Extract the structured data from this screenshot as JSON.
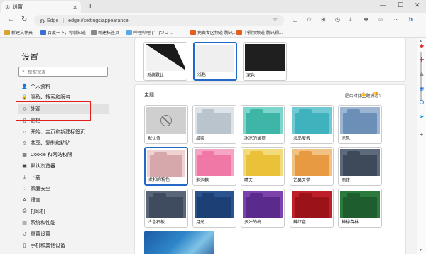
{
  "browser": {
    "tab_title": "设置",
    "address_brand": "Edge",
    "address_url": "edge://settings/appearance",
    "favorites": [
      {
        "label": "新建文件夹",
        "color": "#d9a531"
      },
      {
        "label": "百度一下，你就知道",
        "color": "#3a6fd8"
      },
      {
        "label": "新建标签页",
        "color": "#888888"
      },
      {
        "label": "哔哩哔哩 ( '- ')つロ ...",
        "color": "#5aa9e6"
      },
      {
        "label": "免费专区频道-腾讯...",
        "color": "#e65c1a"
      },
      {
        "label": "中视频频道-腾讯视...",
        "color": "#e65c1a"
      }
    ]
  },
  "sidebar": {
    "title": "设置",
    "search_placeholder": "搜索设置",
    "items": [
      {
        "label": "个人资料",
        "icon": "person-icon"
      },
      {
        "label": "隐私、搜索和服务",
        "icon": "lock-icon"
      },
      {
        "label": "外观",
        "icon": "palette-icon",
        "active": true
      },
      {
        "label": "侧栏",
        "icon": "sidebar-icon"
      },
      {
        "label": "开始、主页和新建标签页",
        "icon": "home-icon"
      },
      {
        "label": "共享、复制和粘贴",
        "icon": "share-icon"
      },
      {
        "label": "Cookie 和网站权限",
        "icon": "cookie-icon"
      },
      {
        "label": "默认浏览器",
        "icon": "browser-icon"
      },
      {
        "label": "下载",
        "icon": "download-icon"
      },
      {
        "label": "家庭安全",
        "icon": "family-icon"
      },
      {
        "label": "语言",
        "icon": "language-icon"
      },
      {
        "label": "打印机",
        "icon": "printer-icon"
      },
      {
        "label": "系统和性能",
        "icon": "system-icon"
      },
      {
        "label": "重置设置",
        "icon": "reset-icon"
      },
      {
        "label": "手机和其他设备",
        "icon": "phone-icon"
      }
    ]
  },
  "main": {
    "appearance_options": [
      {
        "label": "系统默认"
      },
      {
        "label": "浅色",
        "selected": true
      },
      {
        "label": "深色"
      }
    ],
    "theme_section_title": "主题",
    "feedback_text": "是否对此主题满意?",
    "themes": [
      {
        "label": "默认值",
        "tab": "#c8c8c8",
        "body": "#c8c8c8",
        "default": true
      },
      {
        "label": "晨雾",
        "tab": "#b9c4cc",
        "body": "#dde3e8"
      },
      {
        "label": "冰凉的薄荷",
        "tab": "#3fb5a8",
        "body": "#7dd6cb"
      },
      {
        "label": "海岛度假",
        "tab": "#3fb2bd",
        "body": "#71cad3"
      },
      {
        "label": "凉风",
        "tab": "#6c8fb8",
        "body": "#9cb5d3"
      },
      {
        "label": "柔和的粉色",
        "tab": "#d6a8ab",
        "body": "#efd2d3",
        "selected": true
      },
      {
        "label": "泡泡糖",
        "tab": "#ef78a6",
        "body": "#f6a6c5"
      },
      {
        "label": "晴天",
        "tab": "#e9c23a",
        "body": "#f3da7c"
      },
      {
        "label": "芒果天堂",
        "tab": "#e79a42",
        "body": "#f2c184"
      },
      {
        "label": "雨夜",
        "tab": "#3e4a5a",
        "body": "#5d6a7c"
      },
      {
        "label": "冷色石板",
        "tab": "#3f4b5f",
        "body": "#59667a"
      },
      {
        "label": "月光",
        "tab": "#1c3f75",
        "body": "#2b548f"
      },
      {
        "label": "多汁的梅",
        "tab": "#5a2a8c",
        "body": "#7c43ad"
      },
      {
        "label": "辣红色",
        "tab": "#9b1218",
        "body": "#bf1f28"
      },
      {
        "label": "神秘森林",
        "tab": "#1d5d2e",
        "body": "#2d7a3e"
      }
    ]
  }
}
